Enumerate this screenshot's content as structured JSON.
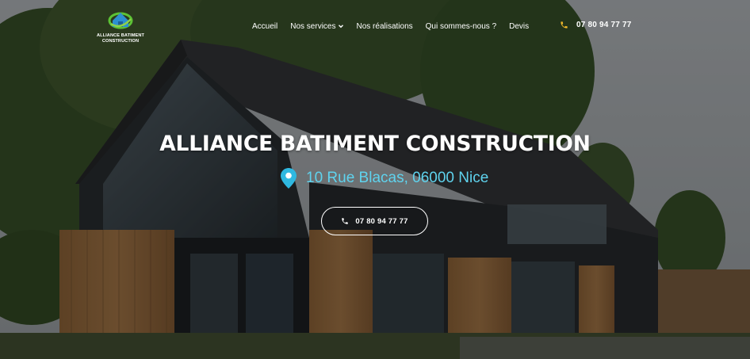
{
  "colors": {
    "accent_phone_icon": "#f0b92a",
    "address_color": "#5fd3ee",
    "pin_color": "#2fb8e0",
    "text_light": "#ffffff"
  },
  "header": {
    "logo": {
      "icon": "house-globe-logo-icon",
      "text_line1": "ALLIANCE BATIMENT",
      "text_line2": "CONSTRUCTION"
    },
    "nav": [
      {
        "label": "Accueil"
      },
      {
        "label": "Nos services",
        "has_dropdown": true,
        "icon": "chevron-down-icon"
      },
      {
        "label": "Nos réalisations"
      },
      {
        "label": "Qui sommes-nous ?"
      },
      {
        "label": "Devis"
      }
    ],
    "phone": {
      "icon": "phone-icon",
      "number": "07 80 94 77 77"
    }
  },
  "hero": {
    "background_image": "modern-wood-house-photo",
    "title": "ALLIANCE BATIMENT CONSTRUCTION",
    "address": {
      "icon": "map-pin-icon",
      "text": "10 Rue Blacas, 06000 Nice"
    },
    "cta": {
      "icon": "phone-icon",
      "label": "07 80 94 77 77"
    }
  }
}
